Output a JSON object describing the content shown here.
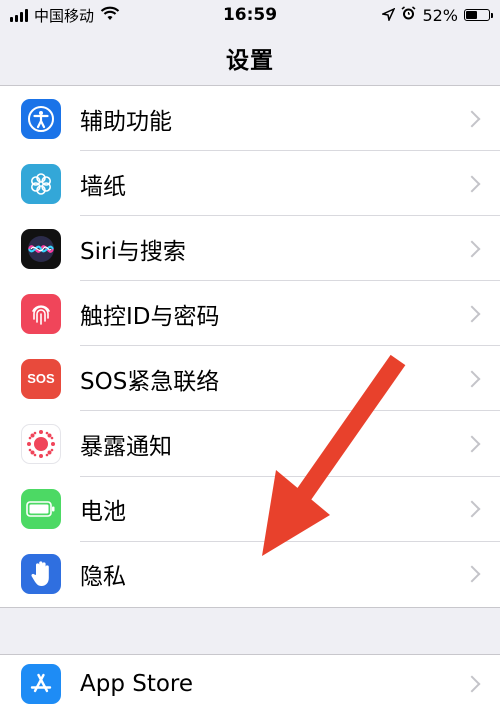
{
  "status_bar": {
    "carrier": "中国移动",
    "time": "16:59",
    "battery_percent": "52%",
    "battery_level": 0.52
  },
  "nav": {
    "title": "设置"
  },
  "settings": {
    "items": [
      {
        "label": "辅助功能",
        "icon": "accessibility-icon",
        "color": "#1a73e8"
      },
      {
        "label": "墙纸",
        "icon": "wallpaper-flower-icon",
        "color": "#33a7d8"
      },
      {
        "label": "Siri与搜索",
        "icon": "siri-icon",
        "color": "#111111"
      },
      {
        "label": "触控ID与密码",
        "icon": "fingerprint-icon",
        "color": "#f0455a"
      },
      {
        "label": "SOS紧急联络",
        "icon": "sos-icon",
        "color": "#e84a3c",
        "icon_text": "SOS"
      },
      {
        "label": "暴露通知",
        "icon": "exposure-notification-icon",
        "color": "#ffffff"
      },
      {
        "label": "电池",
        "icon": "battery-icon",
        "color": "#4cd964"
      },
      {
        "label": "隐私",
        "icon": "hand-icon",
        "color": "#2f6fe0"
      }
    ],
    "store_item": {
      "label": "App Store",
      "icon": "app-store-icon",
      "color": "#1e8cf5"
    }
  },
  "annotation": {
    "color": "#e8412c"
  }
}
